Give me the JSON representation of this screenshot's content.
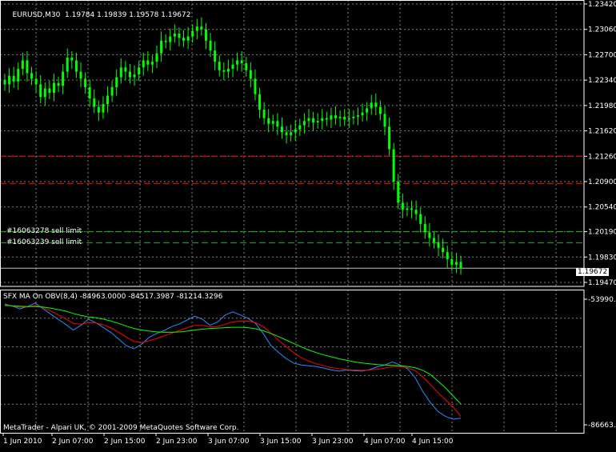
{
  "chart_header": {
    "symbol_timeframe": "EURUSD,M30",
    "ohlc": "1.19784 1.19839 1.19578 1.19672"
  },
  "orders": [
    {
      "label": "#16063278 sell limit"
    },
    {
      "label": "#16063239 sell limit"
    }
  ],
  "current_price_label": "1.19672",
  "indicator_header": "SFX MA On OBV(8,4) -84963.0000 -84517.3987 -81214.3296",
  "copyright": "MetaTrader - Alpari UK, © 2001-2009 MetaQuotes Software Corp.",
  "price_axis_labels": [
    "1.23420",
    "1.23060",
    "1.22700",
    "1.22340",
    "1.21980",
    "1.21620",
    "1.21260",
    "1.20900",
    "1.20540",
    "1.20190",
    "1.19830",
    "1.19470"
  ],
  "indicator_axis_labels": [
    "-53990.9",
    "-86663.1"
  ],
  "time_axis_labels": [
    "1 Jun 2010",
    "2 Jun 07:00",
    "2 Jun 15:00",
    "2 Jun 23:00",
    "3 Jun 07:00",
    "3 Jun 15:00",
    "3 Jun 23:00",
    "4 Jun 07:00",
    "4 Jun 15:00"
  ],
  "colors": {
    "background": "#000000",
    "candle": "#00ff00",
    "grid": "#808080",
    "order_line_red": "#ff0000",
    "order_line_green": "#00c000",
    "obv_line": "#1e90ff",
    "ma_fast": "#ff0000",
    "ma_slow": "#00ff00"
  },
  "chart_data": [
    {
      "type": "candlestick",
      "title": "EURUSD,M30",
      "ylim": [
        1.1947,
        1.2342
      ],
      "levels": {
        "red_dashed": [
          1.2126,
          1.2087
        ],
        "green_dashed": [
          1.2019,
          1.2003
        ],
        "current_price": 1.19672
      },
      "close_series": [
        1.2228,
        1.224,
        1.2232,
        1.225,
        1.2262,
        1.2244,
        1.2236,
        1.2228,
        1.221,
        1.2222,
        1.2216,
        1.223,
        1.2226,
        1.2246,
        1.2266,
        1.2262,
        1.2246,
        1.2236,
        1.2224,
        1.2208,
        1.2196,
        1.2188,
        1.22,
        1.2212,
        1.2224,
        1.2238,
        1.2252,
        1.2246,
        1.2238,
        1.2242,
        1.2252,
        1.2262,
        1.2256,
        1.226,
        1.2272,
        1.229,
        1.2288,
        1.2296,
        1.23,
        1.2294,
        1.229,
        1.2296,
        1.2304,
        1.231,
        1.2306,
        1.229,
        1.2276,
        1.226,
        1.2248,
        1.2246,
        1.225,
        1.2256,
        1.2262,
        1.2258,
        1.2248,
        1.2236,
        1.2214,
        1.2192,
        1.218,
        1.2172,
        1.2176,
        1.2168,
        1.216,
        1.2156,
        1.216,
        1.2164,
        1.217,
        1.2176,
        1.218,
        1.2174,
        1.2176,
        1.218,
        1.2178,
        1.2184,
        1.218,
        1.2182,
        1.2178,
        1.218,
        1.2182,
        1.2184,
        1.2188,
        1.2194,
        1.2202,
        1.2196,
        1.2186,
        1.2168,
        1.2136,
        1.209,
        1.206,
        1.205,
        1.2052,
        1.205,
        1.2044,
        1.203,
        1.2018,
        1.201,
        1.2004,
        1.1996,
        1.199,
        1.198,
        1.1972,
        1.1976,
        1.1967
      ]
    },
    {
      "type": "line",
      "title": "SFX MA On OBV(8,4)",
      "ylim": [
        -86663.1,
        -53990.9
      ],
      "series": [
        {
          "values": [
            -55200,
            -55800,
            -56500,
            -55900,
            -55000,
            -56400,
            -57800,
            -59200,
            -60500,
            -62000,
            -60800,
            -59200,
            -60100,
            -61400,
            -62700,
            -64400,
            -66100,
            -66900,
            -65700,
            -63900,
            -62900,
            -62100,
            -61100,
            -60400,
            -59400,
            -58400,
            -59200,
            -60800,
            -59900,
            -58100,
            -57300,
            -58100,
            -59000,
            -60300,
            -62900,
            -66000,
            -67800,
            -69400,
            -70600,
            -71100,
            -71300,
            -71500,
            -71900,
            -72400,
            -72700,
            -72400,
            -72600,
            -72700,
            -72300,
            -71600,
            -71100,
            -70300,
            -71100,
            -72100,
            -74400,
            -78000,
            -80900,
            -83200,
            -84500,
            -85200,
            -84963
          ]
        },
        {
          "values": [
            -55400,
            -55700,
            -56100,
            -56000,
            -55600,
            -56100,
            -57000,
            -58000,
            -59100,
            -60300,
            -60500,
            -60100,
            -60200,
            -60700,
            -61500,
            -62600,
            -63900,
            -65000,
            -65300,
            -64800,
            -64200,
            -63500,
            -62800,
            -62100,
            -61400,
            -60800,
            -60800,
            -61200,
            -61100,
            -60500,
            -59900,
            -59700,
            -59700,
            -60100,
            -61100,
            -62800,
            -64600,
            -66300,
            -67900,
            -69200,
            -70100,
            -70800,
            -71300,
            -71800,
            -72100,
            -72300,
            -72400,
            -72500,
            -72400,
            -72200,
            -71900,
            -71500,
            -71500,
            -71800,
            -72600,
            -74200,
            -76200,
            -78300,
            -80200,
            -82000,
            -84517
          ]
        },
        {
          "values": [
            -55600,
            -55700,
            -55800,
            -55900,
            -55900,
            -56000,
            -56300,
            -56700,
            -57100,
            -57700,
            -58200,
            -58600,
            -58800,
            -59200,
            -59700,
            -60300,
            -61000,
            -61600,
            -62000,
            -62300,
            -62500,
            -62600,
            -62600,
            -62500,
            -62300,
            -62000,
            -61800,
            -61600,
            -61500,
            -61400,
            -61300,
            -61300,
            -61400,
            -61700,
            -62200,
            -62900,
            -63700,
            -64600,
            -65500,
            -66400,
            -67200,
            -67900,
            -68500,
            -69000,
            -69500,
            -69900,
            -70300,
            -70600,
            -70800,
            -71000,
            -71100,
            -71200,
            -71300,
            -71500,
            -71800,
            -72500,
            -73600,
            -75300,
            -77100,
            -79200,
            -81214
          ]
        }
      ]
    }
  ]
}
